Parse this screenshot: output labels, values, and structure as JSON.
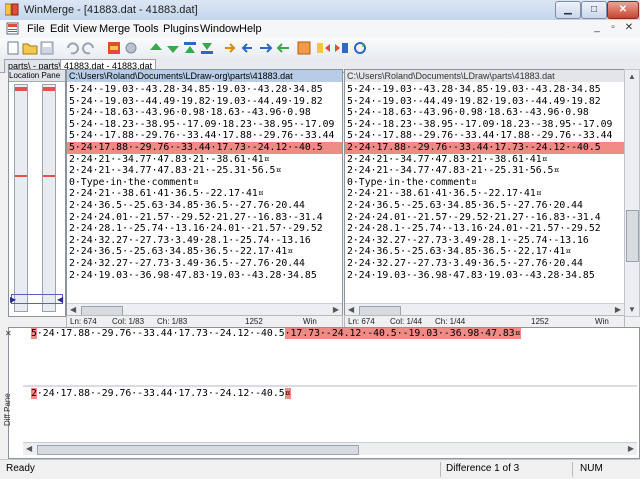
{
  "window": {
    "title": "WinMerge - [41883.dat - 41883.dat]"
  },
  "menu": [
    "File",
    "Edit",
    "View",
    "Merge",
    "Tools",
    "Plugins",
    "Window",
    "Help"
  ],
  "tabs": [
    "parts\\ - parts\\",
    "41883.dat - 41883.dat"
  ],
  "location_pane": {
    "title": "Location Pane"
  },
  "left_pane": {
    "path": "C:\\Users\\Roland\\Documents\\LDraw-org\\parts\\41883.dat",
    "lines": [
      "5·24·-19.03·-43.28·34.85·19.03·-43.28·34.85",
      "5·24·-19.03·-44.49·19.82·19.03·-44.49·19.82",
      "5·24·-18.63·-43.96·0.98·18.63·-43.96·0.98",
      "5·24·-18.23·-38.95·-17.09·18.23·-38.95·-17.09",
      "5·24·-17.88·-29.76·-33.44·17.88·-29.76·-33.44",
      "5·24·17.88·-29.76·-33.44·17.73·-24.12·-40.5",
      "2·24·21·-34.77·47.83·21·-38.61·41¤",
      "2·24·21·-34.77·47.83·21·-25.31·56.5¤",
      "0·Type·in·the·comment¤",
      "2·24·21·-38.61·41·36.5·-22.17·41¤",
      "2·24·36.5·-25.63·34.85·36.5·-27.76·20.44",
      "2·24·24.01·-21.57·-29.52·21.27·-16.83·-31.4",
      "2·24·28.1·-25.74·-13.16·24.01·-21.57·-29.52",
      "2·24·32.27·-27.73·3.49·28.1·-25.74·-13.16",
      "2·24·36.5·-25.63·34.85·36.5·-22.17·41¤",
      "2·24·32.27·-27.73·3.49·36.5·-27.76·20.44",
      "2·24·19.03·-36.98·47.83·19.03·-43.28·34.85"
    ],
    "status": {
      "ln": "Ln: 674",
      "col": "Col: 1/83",
      "ch": "Ch: 1/83",
      "enc": "1252",
      "eol": "Win"
    }
  },
  "right_pane": {
    "path": "C:\\Users\\Roland\\Documents\\LDraw\\parts\\41883.dat",
    "lines": [
      "5·24·-19.03·-43.28·34.85·19.03·-43.28·34.85",
      "5·24·-19.03·-44.49·19.82·19.03·-44.49·19.82",
      "5·24·-18.63·-43.96·0.98·18.63·-43.96·0.98",
      "5·24·-18.23·-38.95·-17.09·18.23·-38.95·-17.09",
      "5·24·-17.88·-29.76·-33.44·17.88·-29.76·-33.44",
      "2·24·17.88·-29.76·-33.44·17.73·-24.12·-40.5",
      "2·24·21·-34.77·47.83·21·-38.61·41¤",
      "2·24·21·-34.77·47.83·21·-25.31·56.5¤",
      "0·Type·in·the·comment¤",
      "2·24·21·-38.61·41·36.5·-22.17·41¤",
      "2·24·36.5·-25.63·34.85·36.5·-27.76·20.44",
      "2·24·24.01·-21.57·-29.52·21.27·-16.83·-31.4",
      "2·24·28.1·-25.74·-13.16·24.01·-21.57·-29.52",
      "2·24·32.27·-27.73·3.49·28.1·-25.74·-13.16",
      "2·24·36.5·-25.63·34.85·36.5·-22.17·41¤",
      "2·24·32.27·-27.73·3.49·36.5·-27.76·20.44",
      "2·24·19.03·-36.98·47.83·19.03·-43.28·34.85"
    ],
    "status": {
      "ln": "Ln: 674",
      "col": "Col: 1/44",
      "ch": "Ch: 1/44",
      "enc": "1252",
      "eol": "Win"
    }
  },
  "diff_pane": {
    "title": "Diff Pane",
    "top": {
      "first_char": "5",
      "same": "·24·17.88·-29.76·-33.44·17.73·-24.12·-40.5",
      "extra": "·17.73·-24.12·-40.5·-19.03·-36.98·47.83¤"
    },
    "bottom": {
      "first_char": "2",
      "same": "·24·17.88·-29.76·-33.44·17.73·-24.12·-40.5",
      "end": "¤"
    }
  },
  "statusbar": {
    "left": "Ready",
    "difference": "Difference 1 of 3",
    "num": "NUM"
  },
  "colors": {
    "diff": "#ef8a84",
    "left_header": "#b7cce6"
  }
}
